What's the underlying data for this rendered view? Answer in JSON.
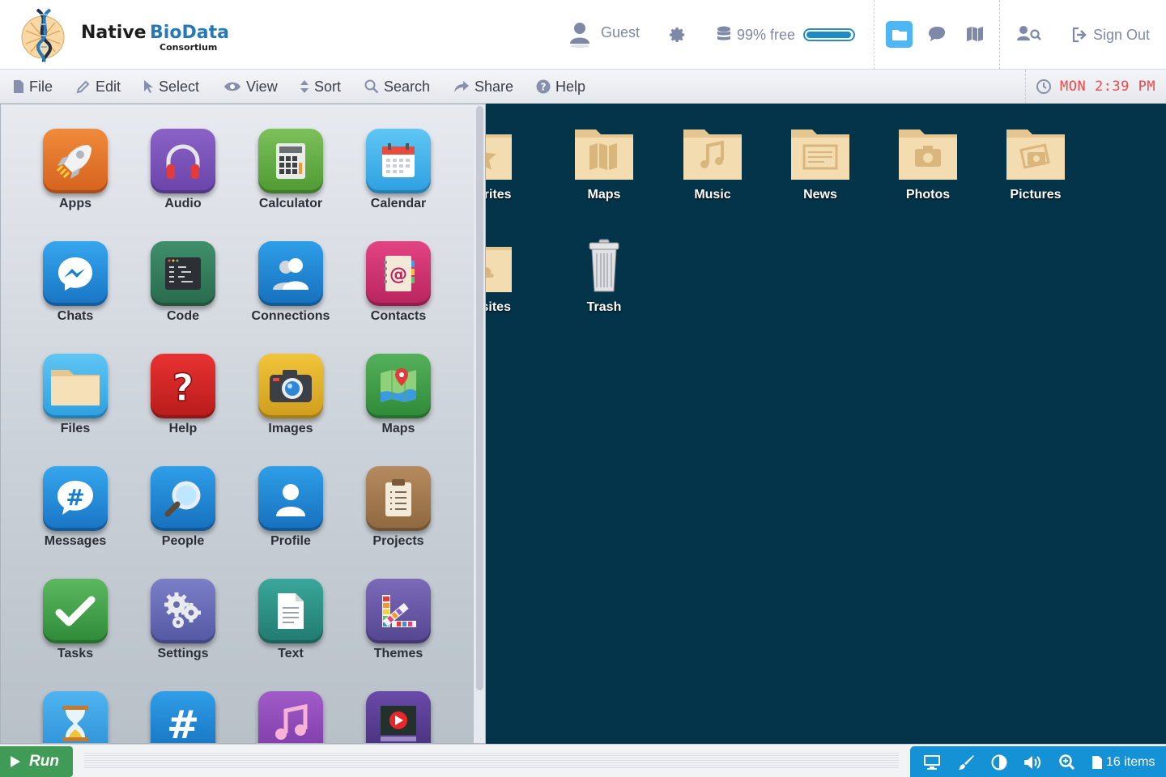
{
  "header": {
    "brand_main": "Native",
    "brand_accent": "BioData",
    "brand_sub": "Consortium",
    "user_label": "Guest",
    "storage_label": "99% free",
    "storage_fraction": 0.99,
    "signout_label": "Sign Out"
  },
  "menu": {
    "file": "File",
    "edit": "Edit",
    "select": "Select",
    "view": "View",
    "sort": "Sort",
    "search": "Search",
    "share": "Share",
    "help": "Help",
    "clock": "MON 2:39 PM"
  },
  "desktop": {
    "items": [
      {
        "label": "Favorites",
        "icon": "star-folder-icon"
      },
      {
        "label": "Maps",
        "icon": "map-folder-icon"
      },
      {
        "label": "Music",
        "icon": "music-folder-icon"
      },
      {
        "label": "News",
        "icon": "news-folder-icon"
      },
      {
        "label": "Photos",
        "icon": "camera-folder-icon"
      },
      {
        "label": "Pictures",
        "icon": "pictures-folder-icon"
      },
      {
        "label": "Websites",
        "icon": "cloud-folder-icon"
      },
      {
        "label": "Trash",
        "icon": "trash-icon"
      }
    ]
  },
  "launcher": {
    "apps": [
      {
        "label": "Apps",
        "icon": "rocket-icon"
      },
      {
        "label": "Audio",
        "icon": "headphones-icon"
      },
      {
        "label": "Calculator",
        "icon": "calculator-icon"
      },
      {
        "label": "Calendar",
        "icon": "calendar-icon"
      },
      {
        "label": "Chats",
        "icon": "messenger-icon"
      },
      {
        "label": "Code",
        "icon": "code-icon"
      },
      {
        "label": "Connections",
        "icon": "connections-icon"
      },
      {
        "label": "Contacts",
        "icon": "address-book-icon"
      },
      {
        "label": "Files",
        "icon": "folder-icon"
      },
      {
        "label": "Help",
        "icon": "question-icon"
      },
      {
        "label": "Images",
        "icon": "camera-icon"
      },
      {
        "label": "Maps",
        "icon": "map-pin-icon"
      },
      {
        "label": "Messages",
        "icon": "hashtag-bubble-icon"
      },
      {
        "label": "People",
        "icon": "magnifier-icon"
      },
      {
        "label": "Profile",
        "icon": "user-silhouette-icon"
      },
      {
        "label": "Projects",
        "icon": "clipboard-icon"
      },
      {
        "label": "Tasks",
        "icon": "checkmark-icon"
      },
      {
        "label": "Settings",
        "icon": "gears-icon"
      },
      {
        "label": "Text",
        "icon": "document-icon"
      },
      {
        "label": "Themes",
        "icon": "palette-icon"
      },
      {
        "label": "",
        "icon": "hourglass-icon"
      },
      {
        "label": "",
        "icon": "hashtag-icon"
      },
      {
        "label": "",
        "icon": "music-note-icon"
      },
      {
        "label": "",
        "icon": "video-icon"
      }
    ]
  },
  "taskbar": {
    "run_label": "Run",
    "items_count": "16 items"
  },
  "colors": {
    "desktop_bg": "#03344a",
    "accent": "#1592d6",
    "run_green": "#3f9b55",
    "clock_red": "#f04848",
    "folder": "#f3dcb0"
  }
}
